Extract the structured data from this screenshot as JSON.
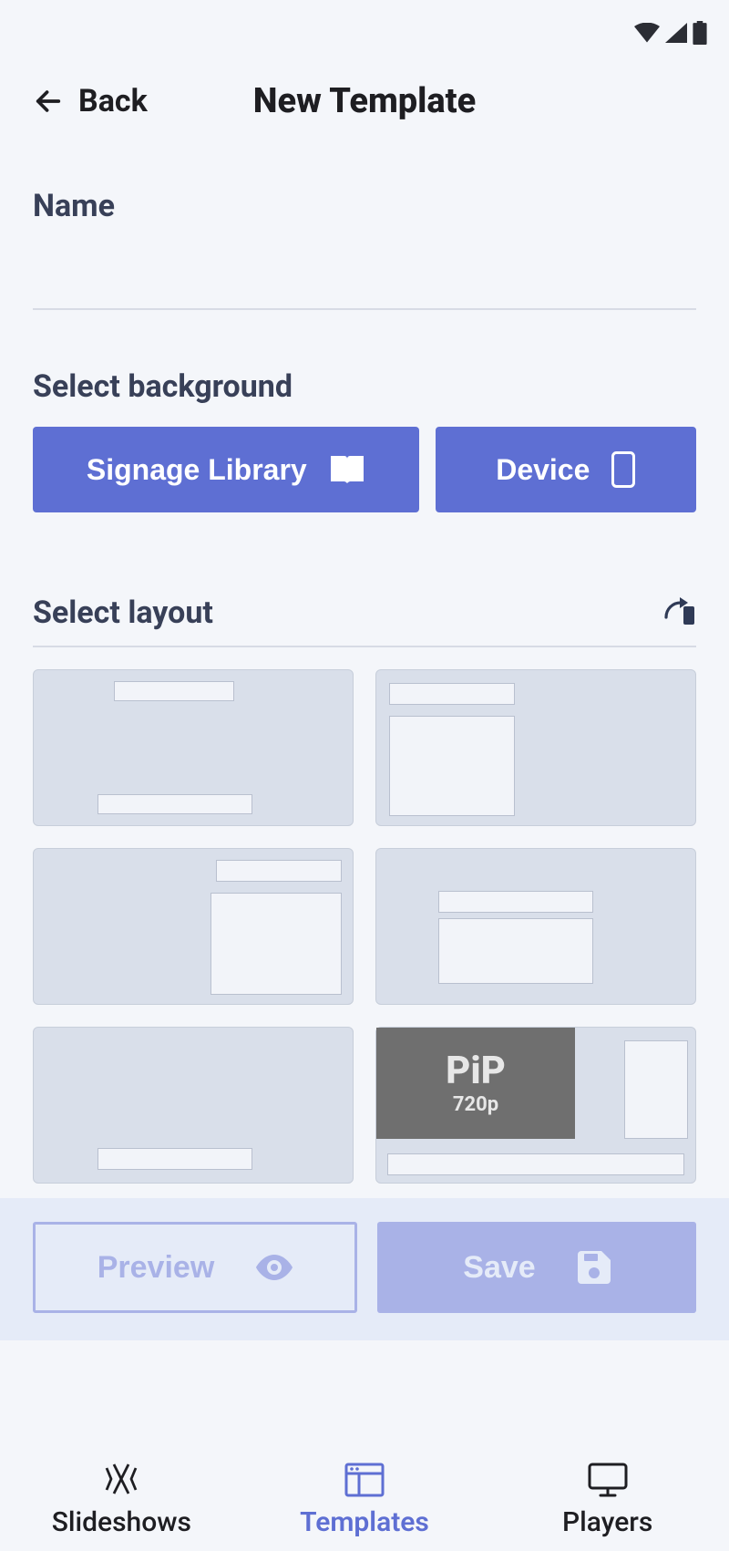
{
  "header": {
    "back_label": "Back",
    "title": "New Template"
  },
  "name": {
    "label": "Name",
    "value": ""
  },
  "background": {
    "label": "Select background",
    "signage_label": "Signage Library",
    "device_label": "Device"
  },
  "layout": {
    "label": "Select layout",
    "pip": {
      "title": "PiP",
      "subtitle": "720p"
    }
  },
  "actions": {
    "preview": "Preview",
    "save": "Save"
  },
  "nav": {
    "slideshows": "Slideshows",
    "templates": "Templates",
    "players": "Players"
  }
}
